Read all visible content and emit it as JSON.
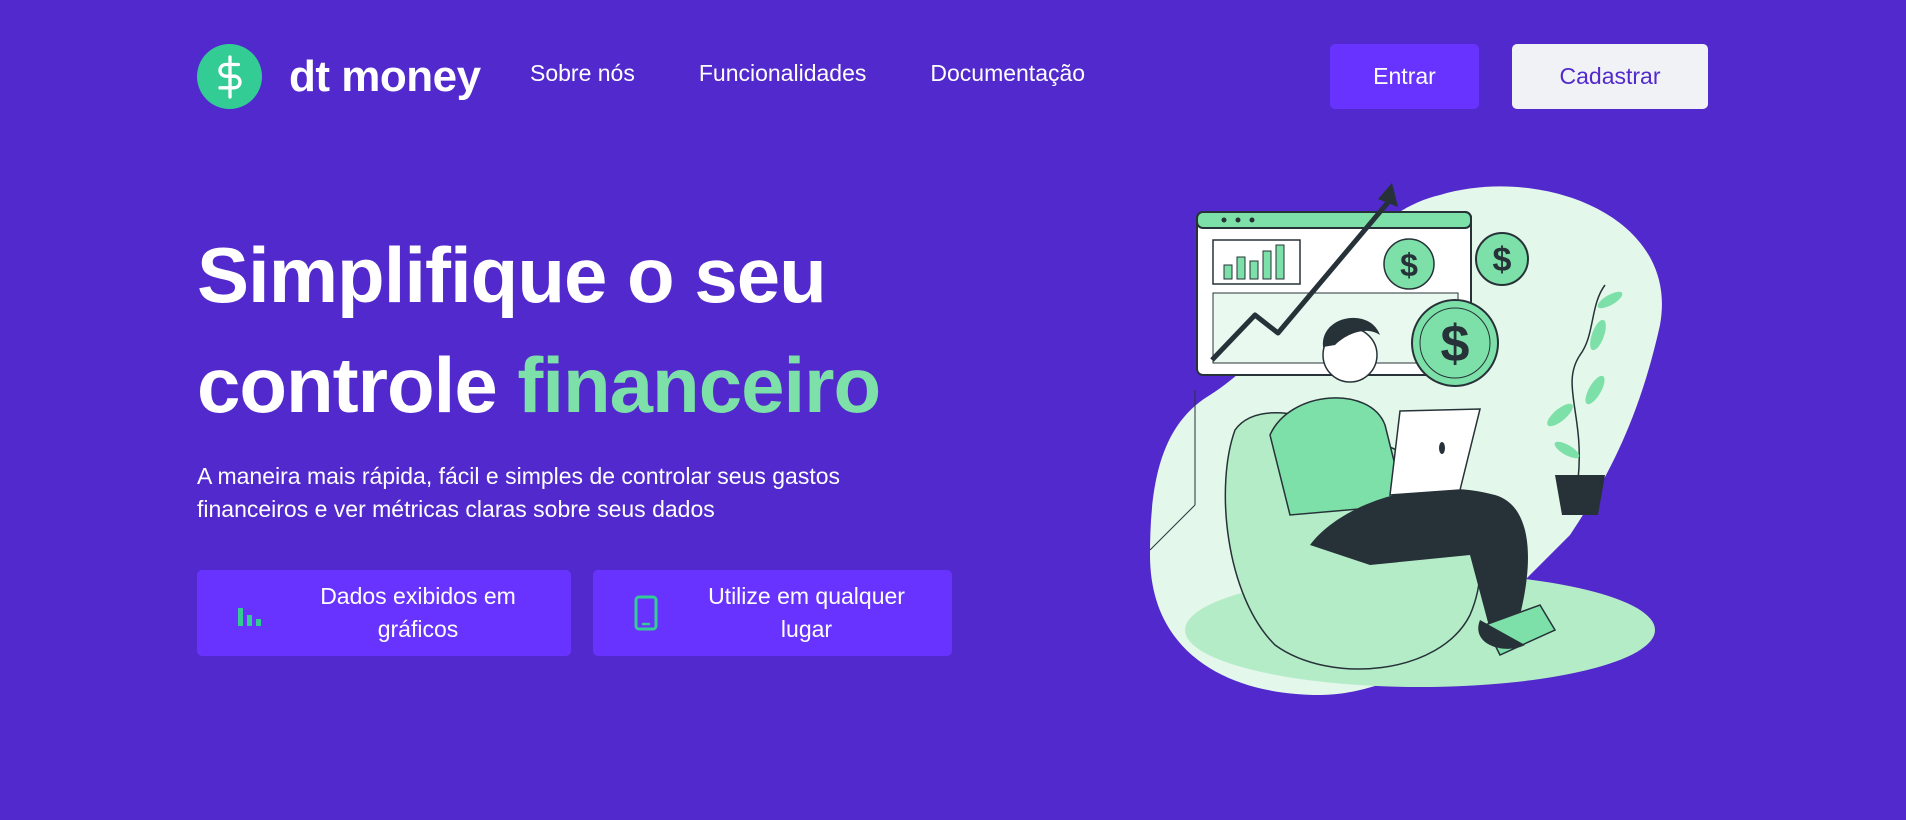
{
  "brand": {
    "name": "dt money",
    "logo_icon": "dollar-sign-icon",
    "accent_green": "#33cc95",
    "purple": "#5229cc"
  },
  "nav": {
    "items": [
      {
        "label": "Sobre nós"
      },
      {
        "label": "Funcionalidades"
      },
      {
        "label": "Documentação"
      }
    ]
  },
  "header": {
    "login_label": "Entrar",
    "signup_label": "Cadastrar"
  },
  "hero": {
    "title_line1": "Simplifique o seu",
    "title_line2_plain": "controle",
    "title_line2_accent": "financeiro",
    "subtitle": "A maneira mais rápida, fácil e simples de controlar seus gastos financeiros e ver métricas claras sobre seus dados"
  },
  "features": [
    {
      "icon": "bar-chart-icon",
      "label": "Dados exibidos em gráficos"
    },
    {
      "icon": "smartphone-icon",
      "label": "Utilize em qualquer lugar"
    }
  ]
}
